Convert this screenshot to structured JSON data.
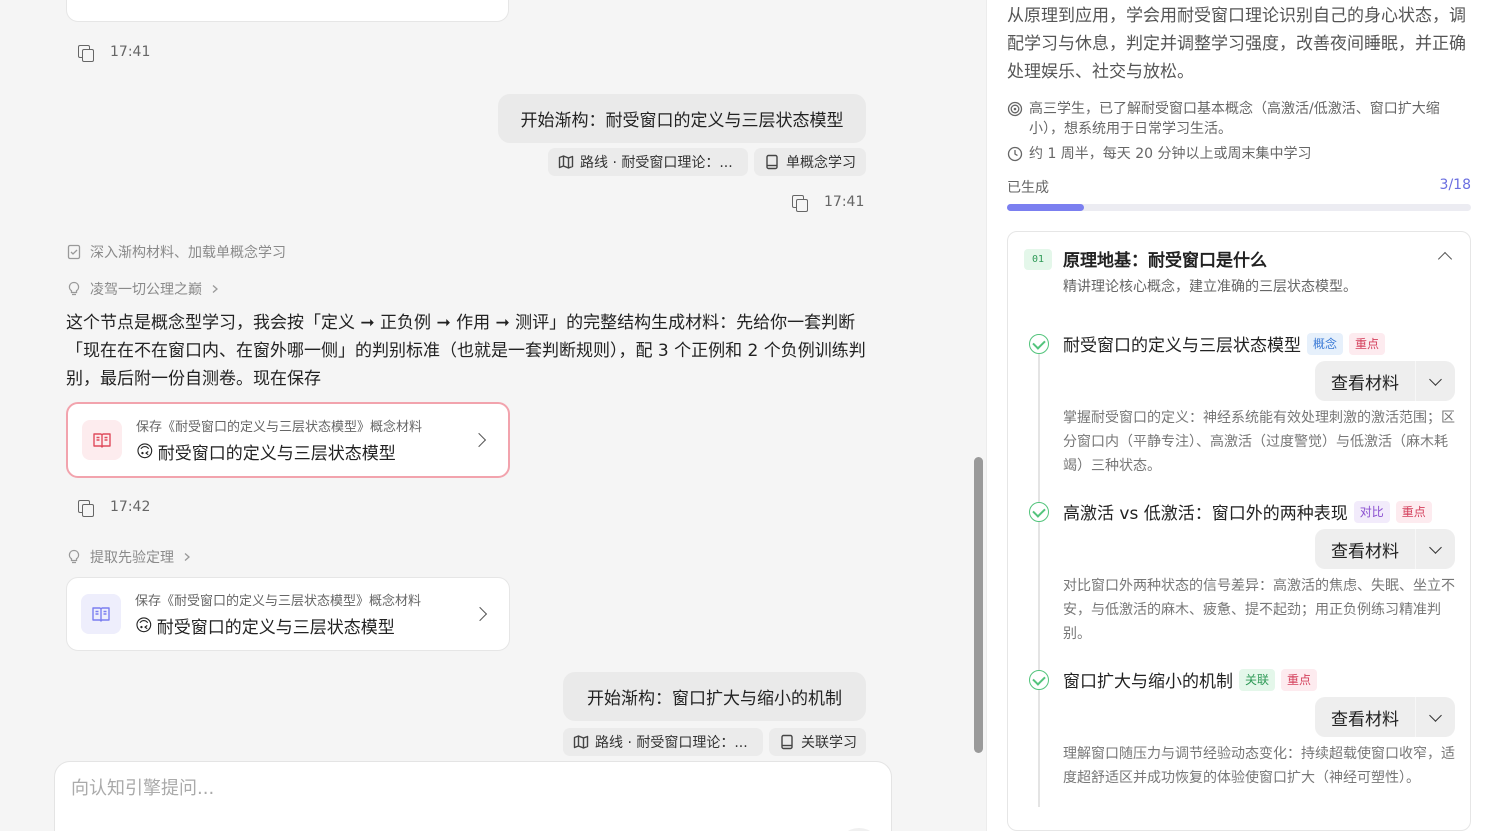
{
  "chat": {
    "top_time": "17:41",
    "user_msg_1": {
      "text": "开始渐构：耐受窗口的定义与三层状态模型",
      "chips": [
        "路线 · 耐受窗口理论：...",
        "单概念学习"
      ],
      "time": "17:41"
    },
    "step_1": "深入渐构材料、加载单概念学习",
    "step_2": "凌驾一切公理之巅",
    "paragraph": "这个节点是概念型学习，我会按「定义 ➞ 正负例 ➞ 作用 ➞ 测评」的完整结构生成材料：先给你一套判断「现在在不在窗口内、在窗外哪一侧」的判别标准（也就是一套判断规则），配 3 个正例和 2 个负例训练判别，最后附一份自测卷。现在保存",
    "card_1": {
      "subtitle": "保存《耐受窗口的定义与三层状态模型》概念材料",
      "emoji": "🙃",
      "title": "耐受窗口的定义与三层状态模型"
    },
    "time_2": "17:42",
    "step_3": "提取先验定理",
    "card_2": {
      "subtitle": "保存《耐受窗口的定义与三层状态模型》概念材料",
      "emoji": "🙃",
      "title": "耐受窗口的定义与三层状态模型"
    },
    "user_msg_2": {
      "text": "开始渐构：窗口扩大与缩小的机制",
      "chips": [
        "路线 · 耐受窗口理论：...",
        "关联学习"
      ]
    },
    "input_placeholder": "向认知引擎提问..."
  },
  "panel": {
    "description": "从原理到应用，学会用耐受窗口理论识别自己的身心状态，调配学习与休息，判定并调整学习强度，改善夜间睡眠，并正确处理娱乐、社交与放松。",
    "audience": "高三学生，已了解耐受窗口基本概念（高激活/低激活、窗口扩大缩小），想系统用于日常学习生活。",
    "duration": "约 1 周半，每天 20 分钟以上或周末集中学习",
    "progress_label": "已生成",
    "progress_count": "3/18",
    "progress_fraction": 0.1667,
    "module": {
      "number": "01",
      "title": "原理地基：耐受窗口是什么",
      "subtitle": "精讲理论核心概念，建立准确的三层状态模型。",
      "items": [
        {
          "title": "耐受窗口的定义与三层状态模型",
          "tags": [
            "概念",
            "重点"
          ],
          "button": "查看材料",
          "desc": "掌握耐受窗口的定义：神经系统能有效处理刺激的激活范围；区分窗口内（平静专注）、高激活（过度警觉）与低激活（麻木耗竭）三种状态。"
        },
        {
          "title": "高激活 vs 低激活：窗口外的两种表现",
          "tags": [
            "对比",
            "重点"
          ],
          "button": "查看材料",
          "desc": "对比窗口外两种状态的信号差异：高激活的焦虑、失眠、坐立不安，与低激活的麻木、疲惫、提不起劲；用正负例练习精准判别。"
        },
        {
          "title": "窗口扩大与缩小的机制",
          "tags": [
            "关联",
            "重点"
          ],
          "button": "查看材料",
          "desc": "理解窗口随压力与调节经验动态变化：持续超载使窗口收窄，适度超舒适区并成功恢复的体验使窗口扩大（神经可塑性）。"
        }
      ]
    }
  },
  "colors": {
    "accent": "#7b7ff0",
    "success": "#53c47c",
    "active_card_border": "#f2a3ad"
  }
}
